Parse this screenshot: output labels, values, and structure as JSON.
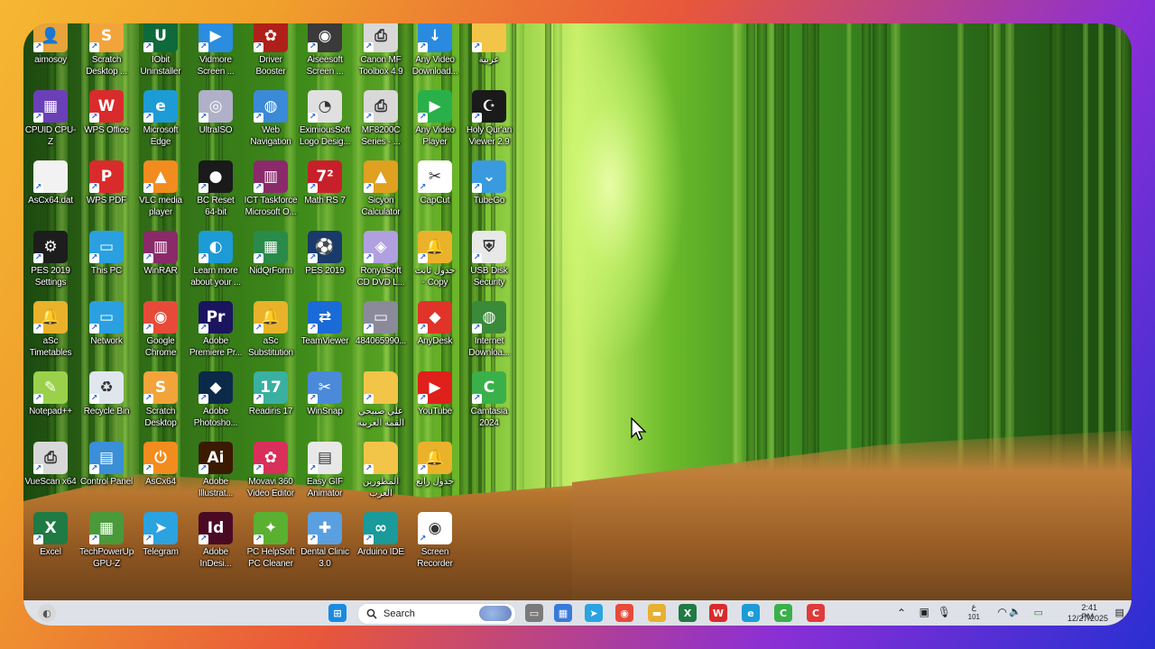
{
  "colors": {
    "taskbar_bg": "#e6ecf5",
    "accent": "#2663d6"
  },
  "desktop": {
    "columns": [
      [
        {
          "label": "aimosoy",
          "icon": "person-folder-icon",
          "color": "#e8a33a",
          "glyph": "👤"
        },
        {
          "label": "CPUID CPU-Z",
          "icon": "cpuz-icon",
          "color": "#6b3fb8",
          "glyph": "▦"
        },
        {
          "label": "AsCx64.dat",
          "icon": "file-icon",
          "color": "#f2f2f2",
          "glyph": ""
        },
        {
          "label": "PES 2019\nSettings",
          "icon": "pes-settings-icon",
          "color": "#1d1d1d",
          "glyph": "⚙"
        },
        {
          "label": "aSc\nTimetables",
          "icon": "bell-icon",
          "color": "#e9b22a",
          "glyph": "🔔"
        },
        {
          "label": "Notepad++",
          "icon": "notepad-plus-icon",
          "color": "#9bd04a",
          "glyph": "✎"
        },
        {
          "label": "VueScan x64",
          "icon": "vuescan-icon",
          "color": "#d8d8d8",
          "glyph": "⎙"
        },
        {
          "label": "Excel",
          "icon": "excel-icon",
          "color": "#1f7a43",
          "glyph": "X"
        }
      ],
      [
        {
          "label": "Scratch\nDesktop ...",
          "icon": "scratch-icon",
          "color": "#f2a43a",
          "glyph": "S"
        },
        {
          "label": "WPS Office",
          "icon": "wps-office-icon",
          "color": "#d92b2b",
          "glyph": "W"
        },
        {
          "label": "WPS PDF",
          "icon": "wps-pdf-icon",
          "color": "#d92b2b",
          "glyph": "P"
        },
        {
          "label": "This PC",
          "icon": "monitor-icon",
          "color": "#2aa0e0",
          "glyph": "▭"
        },
        {
          "label": "Network",
          "icon": "network-icon",
          "color": "#2aa0e0",
          "glyph": "▭"
        },
        {
          "label": "Recycle Bin",
          "icon": "recycle-bin-icon",
          "color": "#dfe6ee",
          "glyph": "♻"
        },
        {
          "label": "Control Panel",
          "icon": "control-panel-icon",
          "color": "#3a8fd8",
          "glyph": "▤"
        },
        {
          "label": "TechPowerUp\nGPU-Z",
          "icon": "gpuz-icon",
          "color": "#4a9a3a",
          "glyph": "▦"
        }
      ],
      [
        {
          "label": "IObit\nUninstaller",
          "icon": "iobit-icon",
          "color": "#0e6a3a",
          "glyph": "U"
        },
        {
          "label": "Microsoft\nEdge",
          "icon": "edge-icon",
          "color": "#1d9bd6",
          "glyph": "e"
        },
        {
          "label": "VLC media\nplayer",
          "icon": "vlc-icon",
          "color": "#f28c1e",
          "glyph": "▲"
        },
        {
          "label": "WinRAR",
          "icon": "winrar-icon",
          "color": "#8a2a6a",
          "glyph": "▥"
        },
        {
          "label": "Google\nChrome",
          "icon": "chrome-icon",
          "color": "#e84a3a",
          "glyph": "◉"
        },
        {
          "label": "Scratch\nDesktop",
          "icon": "scratch-desktop-icon",
          "color": "#f2a43a",
          "glyph": "S"
        },
        {
          "label": "AsCx64",
          "icon": "ascx-icon",
          "color": "#f28c1e",
          "glyph": "⏻"
        },
        {
          "label": "Telegram",
          "icon": "telegram-icon",
          "color": "#2aa3e0",
          "glyph": "➤"
        }
      ],
      [
        {
          "label": "Vidmore\nScreen ...",
          "icon": "vidmore-icon",
          "color": "#2a8de0",
          "glyph": "▶"
        },
        {
          "label": "UltraISO",
          "icon": "disc-icon",
          "color": "#b0b0c8",
          "glyph": "◎"
        },
        {
          "label": "BC Reset\n64-bit",
          "icon": "bc-reset-icon",
          "color": "#1a1a1a",
          "glyph": "●"
        },
        {
          "label": "Learn more\nabout your ...",
          "icon": "spotlight-icon",
          "color": "#1d9bd6",
          "glyph": "◐"
        },
        {
          "label": "Adobe\nPremiere Pr...",
          "icon": "premiere-icon",
          "color": "#1b1560",
          "glyph": "Pr"
        },
        {
          "label": "Adobe\nPhotosho...",
          "icon": "photoshop-icon",
          "color": "#0b2a4a",
          "glyph": "◆"
        },
        {
          "label": "Adobe\nIllustrat...",
          "icon": "illustrator-icon",
          "color": "#3a1a00",
          "glyph": "Ai"
        },
        {
          "label": "Adobe\nInDesi...",
          "icon": "indesign-icon",
          "color": "#4a0a24",
          "glyph": "Id"
        }
      ],
      [
        {
          "label": "Driver\nBooster",
          "icon": "driver-booster-icon",
          "color": "#b0201a",
          "glyph": "✿"
        },
        {
          "label": "Web\nNavigation",
          "icon": "globe-icon",
          "color": "#3a8ad8",
          "glyph": "◍"
        },
        {
          "label": "ICT Taskforce\nMicrosoft O...",
          "icon": "winrar-ict-icon",
          "color": "#8a2a6a",
          "glyph": "▥"
        },
        {
          "label": "NidQrForm",
          "icon": "qr-form-icon",
          "color": "#2a8a4a",
          "glyph": "▦"
        },
        {
          "label": "aSc\nSubstitution",
          "icon": "bell-substitution-icon",
          "color": "#e9b22a",
          "glyph": "🔔"
        },
        {
          "label": "Readiris 17",
          "icon": "readiris-icon",
          "color": "#3ab0a0",
          "glyph": "17"
        },
        {
          "label": "Movavi 360\nVideo Editor",
          "icon": "movavi-icon",
          "color": "#d8305a",
          "glyph": "✿"
        },
        {
          "label": "PC HelpSoft\nPC Cleaner",
          "icon": "pc-cleaner-icon",
          "color": "#5ab030",
          "glyph": "✦"
        }
      ],
      [
        {
          "label": "Aiseesoft\nScreen ...",
          "icon": "aiseesoft-icon",
          "color": "#3a3a3a",
          "glyph": "◉"
        },
        {
          "label": "EximiousSoft\nLogo Desig...",
          "icon": "eximious-icon",
          "color": "#e0e0e0",
          "glyph": "◔"
        },
        {
          "label": "Math RS 7",
          "icon": "math-rs-icon",
          "color": "#c8202a",
          "glyph": "7²"
        },
        {
          "label": "PES 2019",
          "icon": "pes-icon",
          "color": "#1a3a6a",
          "glyph": "⚽"
        },
        {
          "label": "TeamViewer",
          "icon": "teamviewer-icon",
          "color": "#1a6ad8",
          "glyph": "⇄"
        },
        {
          "label": "WinSnap",
          "icon": "winsnap-icon",
          "color": "#4a8ad8",
          "glyph": "✂"
        },
        {
          "label": "Easy GIF\nAnimator",
          "icon": "gif-animator-icon",
          "color": "#e8e8e8",
          "glyph": "▤"
        },
        {
          "label": "Dental Clinic\n3.0",
          "icon": "dental-icon",
          "color": "#5aa0e0",
          "glyph": "✚"
        }
      ],
      [
        {
          "label": "Canon MF\nToolbox 4.9",
          "icon": "printer-icon",
          "color": "#d8d8d8",
          "glyph": "⎙"
        },
        {
          "label": "MF8200C\nSeries - ...",
          "icon": "printer-series-icon",
          "color": "#d8d8d8",
          "glyph": "⎙"
        },
        {
          "label": "Sicyon\nCalculator",
          "icon": "calculator-icon",
          "color": "#e0a020",
          "glyph": "▲"
        },
        {
          "label": "RonyaSoft\nCD DVD L...",
          "icon": "ronyasoft-icon",
          "color": "#b0a0e0",
          "glyph": "◈"
        },
        {
          "label": "484065990...",
          "icon": "image-file-icon",
          "color": "#8a8a9a",
          "glyph": "▭"
        },
        {
          "label": "علي صبيحي\nالقمة العربية",
          "icon": "folder-icon",
          "color": "#f2c448",
          "glyph": ""
        },
        {
          "label": "المطورين\nالعرب",
          "icon": "folder-arabic-icon",
          "color": "#f2c448",
          "glyph": ""
        },
        {
          "label": "Arduino IDE",
          "icon": "arduino-icon",
          "color": "#1a9a9a",
          "glyph": "∞"
        }
      ],
      [
        {
          "label": "Any Video\nDownload...",
          "icon": "download-icon",
          "color": "#2a8ae0",
          "glyph": "↓"
        },
        {
          "label": "Any Video\nPlayer",
          "icon": "video-player-icon",
          "color": "#2ab04a",
          "glyph": "▶"
        },
        {
          "label": "CapCut",
          "icon": "capcut-icon",
          "color": "#ffffff",
          "glyph": "✂"
        },
        {
          "label": "جدول ثابت\n- Copy",
          "icon": "bell-copy-icon",
          "color": "#e9b22a",
          "glyph": "🔔"
        },
        {
          "label": "AnyDesk",
          "icon": "anydesk-icon",
          "color": "#e0332a",
          "glyph": "◆"
        },
        {
          "label": "YouTube",
          "icon": "youtube-icon",
          "color": "#e0201a",
          "glyph": "▶"
        },
        {
          "label": "جدول رابع",
          "icon": "bell-schedule-icon",
          "color": "#e9b22a",
          "glyph": "🔔"
        },
        {
          "label": "Screen\nRecorder",
          "icon": "screen-recorder-icon",
          "color": "#ffffff",
          "glyph": "◉"
        }
      ],
      [
        {
          "label": "عربية",
          "icon": "folder-arabia-icon",
          "color": "#f2c448",
          "glyph": ""
        },
        {
          "label": "Holy Qur'an\nViewer 2.9",
          "icon": "quran-icon",
          "color": "#1a1a1a",
          "glyph": "☪"
        },
        {
          "label": "TubeGo",
          "icon": "tubego-icon",
          "color": "#3a9ae0",
          "glyph": "⌄"
        },
        {
          "label": "USB Disk\nSecurity",
          "icon": "usb-security-icon",
          "color": "#e8e8e8",
          "glyph": "⛨"
        },
        {
          "label": "Internet\nDownloa...",
          "icon": "idm-icon",
          "color": "#3a8a3a",
          "glyph": "◍"
        },
        {
          "label": "Camtasia\n2024",
          "icon": "camtasia-icon",
          "color": "#3ab04a",
          "glyph": "C"
        }
      ]
    ]
  },
  "taskbar": {
    "search_placeholder": "Search",
    "apps": [
      {
        "name": "start-icon",
        "color": "#1a8ae0",
        "glyph": "⊞"
      },
      {
        "name": "task-view-icon",
        "color": "#7a7a7a",
        "glyph": "▭"
      },
      {
        "name": "store-icon",
        "color": "#3a7ad8",
        "glyph": "▦"
      },
      {
        "name": "telegram-taskbar-icon",
        "color": "#2aa3e0",
        "glyph": "➤"
      },
      {
        "name": "chrome-taskbar-icon",
        "color": "#e84a3a",
        "glyph": "◉"
      },
      {
        "name": "explorer-icon",
        "color": "#e8b030",
        "glyph": "▬"
      },
      {
        "name": "excel-taskbar-icon",
        "color": "#1f7a43",
        "glyph": "X"
      },
      {
        "name": "wps-taskbar-icon",
        "color": "#d92b2b",
        "glyph": "W"
      },
      {
        "name": "edge-taskbar-icon",
        "color": "#1d9bd6",
        "glyph": "e"
      },
      {
        "name": "camtasia-taskbar-icon",
        "color": "#3ab04a",
        "glyph": "C"
      },
      {
        "name": "screen-recorder-taskbar-icon",
        "color": "#e03a3a",
        "glyph": "C"
      }
    ],
    "tray": {
      "lang_top": "ع",
      "lang_bottom": "101",
      "time": "2:41 PM",
      "date": "12/27/2025"
    }
  }
}
